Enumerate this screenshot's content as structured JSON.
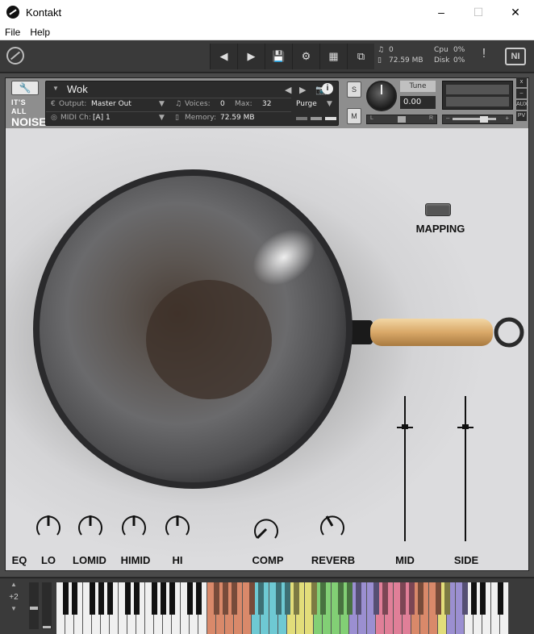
{
  "window": {
    "title": "Kontakt",
    "minimize": "–",
    "maximize": "☐",
    "close": "✕"
  },
  "menu": [
    "File",
    "Help"
  ],
  "toolbar": {
    "stats": {
      "voices_icon": "♫",
      "voices": "0",
      "memory_icon": "▯",
      "memory": "72.59 MB",
      "cpu_label": "Cpu",
      "cpu": "0%",
      "disk_label": "Disk",
      "disk": "0%"
    },
    "warning": "!",
    "ni_logo": "NI"
  },
  "instrument": {
    "brand_line1": "IT'S ALL",
    "brand_line2": "NOISE",
    "name": "Wok",
    "output_label": "Output:",
    "output_value": "Master Out",
    "voices_label": "Voices:",
    "voices_value": "0",
    "max_label": "Max:",
    "max_value": "32",
    "purge": "Purge",
    "midi_label": "MIDI Ch:",
    "midi_value": "[A]  1",
    "memory_label": "Memory:",
    "memory_value": "72.59 MB",
    "solo": "S",
    "mute": "M",
    "tune_label": "Tune",
    "tune_value": "0.00",
    "pan_left": "L",
    "pan_right": "R",
    "vol_minus": "–",
    "vol_plus": "+",
    "side_aux": "AUX",
    "side_pv": "PV",
    "side_close": "x",
    "side_min": "–"
  },
  "gui": {
    "mapping_label": "MAPPING",
    "controls": {
      "eq": "EQ",
      "lo": "LO",
      "lomid": "LOMID",
      "himid": "HIMID",
      "hi": "HI",
      "comp": "COMP",
      "reverb": "REVERB",
      "mid": "MID",
      "side": "SIDE"
    }
  },
  "keyboard": {
    "octave_offset": "+2",
    "colors": {
      "orange": "#d9896a",
      "cyan": "#6ec9d3",
      "yellow": "#e2dd7a",
      "green": "#82cf75",
      "purple": "#9b8fd1",
      "pink": "#e07f98"
    }
  },
  "colors": {
    "panel_dark": "#2b2b2b",
    "gui_bg": "#d4d4d6",
    "handle_wood": "#d9a868"
  }
}
